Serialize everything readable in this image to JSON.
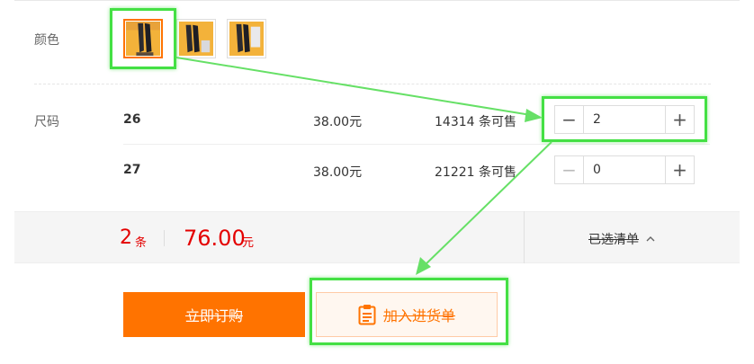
{
  "color": {
    "label": "颜色",
    "swatches": [
      {
        "name": "swatch-1",
        "selected": true
      },
      {
        "name": "swatch-2",
        "selected": false
      },
      {
        "name": "swatch-3",
        "selected": false
      }
    ]
  },
  "size": {
    "label": "尺码",
    "rows": [
      {
        "size": "26",
        "price": "38.00元",
        "stock": "14314 条可售",
        "qty": "2",
        "minus_icon": "minus-icon",
        "plus_icon": "plus-icon"
      },
      {
        "size": "27",
        "price": "38.00元",
        "stock": "21221 条可售",
        "qty": "0",
        "minus_icon": "minus-icon",
        "plus_icon": "plus-icon"
      }
    ]
  },
  "summary": {
    "count": "2",
    "count_unit": "条",
    "total": "76.00",
    "total_unit": "元",
    "selected_list": "已选清单",
    "chevron": "chevron-up-icon"
  },
  "actions": {
    "buy_now": "立即订购",
    "add_to_list": "加入进货单",
    "add_icon": "clipboard-icon"
  },
  "colors": {
    "accent": "#ff7300",
    "price_red": "#e40000",
    "highlight_green": "#44e044"
  }
}
